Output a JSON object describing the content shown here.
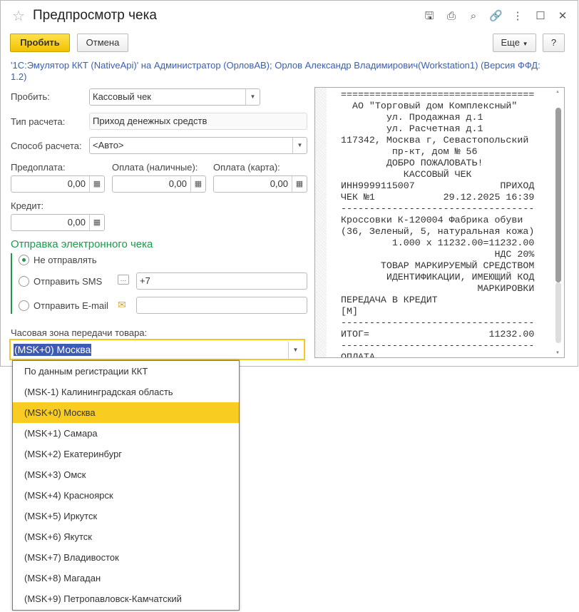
{
  "window": {
    "title": "Предпросмотр чека",
    "icons": [
      "star-icon",
      "save-icon",
      "print-icon",
      "preview-icon",
      "link-icon",
      "more-icon",
      "maximize-icon",
      "close-icon"
    ]
  },
  "toolbar": {
    "primary": "Пробить",
    "cancel": "Отмена",
    "more": "Еще",
    "help": "?"
  },
  "info": "'1С:Эмулятор ККТ (NativeApi)' на Администратор (ОрловАВ); Орлов Александр Владимирович(Workstation1) (Версия ФФД: 1.2)",
  "form": {
    "print_label": "Пробить:",
    "print_value": "Кассовый чек",
    "calc_type_label": "Тип расчета:",
    "calc_type_value": "Приход денежных средств",
    "method_label": "Способ расчета:",
    "method_value": "<Авто>",
    "prepay_label": "Предоплата:",
    "prepay_value": "0,00",
    "cash_label": "Оплата (наличные):",
    "cash_value": "0,00",
    "card_label": "Оплата (карта):",
    "card_value": "0,00",
    "credit_label": "Кредит:",
    "credit_value": "0,00"
  },
  "ereceipt": {
    "title": "Отправка электронного чека",
    "options": [
      "Не отправлять",
      "Отправить SMS",
      "Отправить E-mail"
    ],
    "selected": 0,
    "sms_value": "+7",
    "email_value": ""
  },
  "timezone": {
    "label": "Часовая зона передачи товара:",
    "value": "(MSK+0) Москва",
    "options": [
      "По данным регистрации ККТ",
      "(MSK-1) Калининградская область",
      "(MSK+0) Москва",
      "(MSK+1) Самара",
      "(MSK+2) Екатеринбург",
      "(MSK+3) Омск",
      "(MSK+4) Красноярск",
      "(MSK+5) Иркутск",
      "(MSK+6) Якутск",
      "(MSK+7) Владивосток",
      "(MSK+8) Магадан",
      "(MSK+9) Петропавловск-Камчатский"
    ],
    "highlighted": 2
  },
  "receipt": {
    "lines": [
      "==================================",
      "  АО \"Торговый дом Комплексный\"",
      "        ул. Продажная д.1",
      "        ул. Расчетная д.1",
      "117342, Москва г, Севастопольский",
      "         пр-кт, дом № 56",
      "        ДОБРО ПОЖАЛОВАТЬ!",
      "           КАССОВЫЙ ЧЕК",
      "ИНН9999115007               ПРИХОД",
      "ЧЕК №1            29.12.2025 16:39",
      "----------------------------------",
      "Кроссовки К-120004 Фабрика обуви",
      "(36, Зеленый, 5, натуральная кожа)",
      "         1.000 x 11232.00=11232.00",
      "                           НДС 20%",
      "       ТОВАР МАРКИРУЕМЫЙ СРЕДСТВОМ",
      "        ИДЕНТИФИКАЦИИ, ИМЕЮЩИЙ КОД",
      "                        МАРКИРОВКИ",
      "ПЕРЕДАЧА В КРЕДИТ",
      "[М]",
      "----------------------------------",
      "ИТОГ=                     11232.00",
      "----------------------------------",
      "ОПЛАТА"
    ]
  }
}
